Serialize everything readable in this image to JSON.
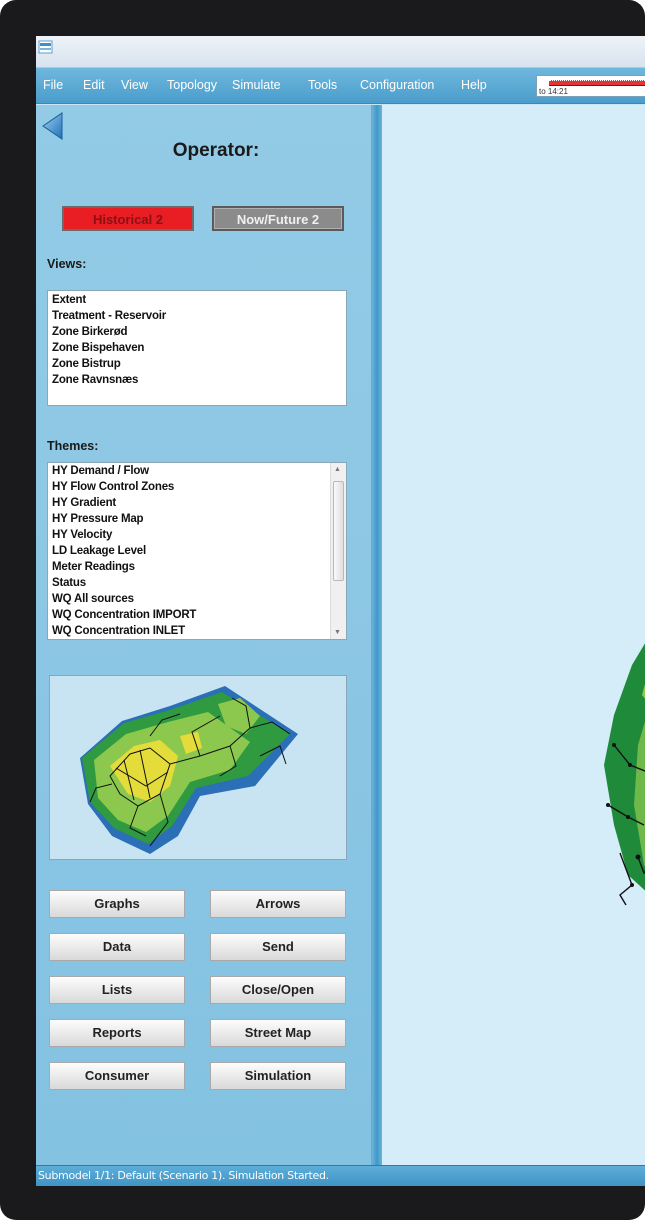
{
  "menu": {
    "items": [
      "File",
      "Edit",
      "View",
      "Topology",
      "Simulate",
      "Tools",
      "Configuration",
      "Help"
    ],
    "timeline_label": "to 14:21"
  },
  "panel": {
    "title": "Operator:",
    "mode_buttons": {
      "historical": "Historical 2",
      "now_future": "Now/Future 2"
    },
    "views": {
      "label": "Views:",
      "items": [
        "Extent",
        "Treatment - Reservoir",
        "Zone Birkerød",
        "Zone Bispehaven",
        "Zone Bistrup",
        "Zone Ravnsnæs"
      ]
    },
    "themes": {
      "label": "Themes:",
      "items": [
        "HY Demand / Flow",
        "HY Flow Control Zones",
        "HY Gradient",
        "HY Pressure Map",
        "HY Velocity",
        "LD Leakage Level",
        "Meter Readings",
        "Status",
        "WQ All sources",
        "WQ Concentration IMPORT",
        "WQ Concentration INLET"
      ]
    },
    "buttons": {
      "graphs": "Graphs",
      "arrows": "Arrows",
      "data": "Data",
      "send": "Send",
      "lists": "Lists",
      "close_open": "Close/Open",
      "reports": "Reports",
      "street_map": "Street Map",
      "consumer": "Consumer",
      "simulation": "Simulation"
    }
  },
  "status": {
    "text": "Submodel 1/1: Default (Scenario 1). Simulation Started."
  },
  "colors": {
    "historical_button": "#e81e24",
    "now_future_button": "#8b8b8b",
    "menubar": "#4a9dcc",
    "panel": "#8cc6e4"
  }
}
